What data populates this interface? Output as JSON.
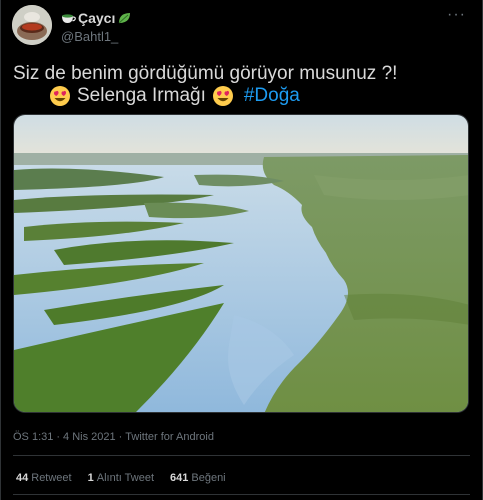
{
  "author": {
    "display_name": "Çaycı",
    "handle": "@Bahtl1_"
  },
  "tweet": {
    "line1": "Siz de benim gördüğümü görüyor musunuz ?!",
    "line2_text": "Selenga Irmağı",
    "hashtag": "#Doğa"
  },
  "meta": {
    "time": "ÖS 1:31",
    "date": "4 Nis 2021",
    "source": "Twitter for Android"
  },
  "stats": {
    "retweets_count": "44",
    "retweets_label": "Retweet",
    "quotes_count": "1",
    "quotes_label": "Alıntı Tweet",
    "likes_count": "641",
    "likes_label": "Beğeni"
  },
  "colors": {
    "background": "#000000",
    "text": "#d9d9d9",
    "muted": "#6e767d",
    "link": "#1d9bf0",
    "border": "#2f3336"
  },
  "icons": [
    "tea-cup-icon",
    "leaf-icon",
    "heart-eyes-emoji",
    "more-options-icon"
  ]
}
